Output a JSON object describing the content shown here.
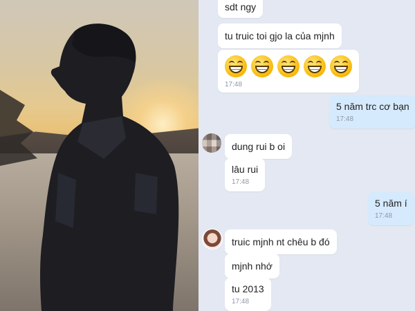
{
  "photo": {
    "alt": "Silhouette of a young man at sunset by a lake"
  },
  "chat": {
    "messages": [
      {
        "id": "m1",
        "direction": "in",
        "text": "sdt ngy",
        "time": ""
      },
      {
        "id": "m2",
        "direction": "in",
        "text": "tu truic toi gjo la của mjnh",
        "time": ""
      },
      {
        "id": "m3",
        "direction": "in",
        "emoji_count": 5,
        "emoji": "grinning-face",
        "time": "17:48"
      },
      {
        "id": "m4",
        "direction": "out",
        "text": "5 năm trc cơ bạn",
        "time": "17:48"
      },
      {
        "id": "m5",
        "direction": "in",
        "text": "dung rui b oi",
        "time": ""
      },
      {
        "id": "m6",
        "direction": "in",
        "text": "lâu rui",
        "time": "17:48"
      },
      {
        "id": "m7",
        "direction": "out",
        "text": "5 năm í",
        "time": "17:48"
      },
      {
        "id": "m8",
        "direction": "in",
        "text": "truic mjnh nt chêu b đó",
        "time": ""
      },
      {
        "id": "m9",
        "direction": "in",
        "text": "mjnh nhớ",
        "time": ""
      },
      {
        "id": "m10",
        "direction": "in",
        "text": "tu 2013",
        "time": "17:48"
      }
    ]
  },
  "colors": {
    "chat_bg": "#e3e8f3",
    "incoming_bubble": "#ffffff",
    "outgoing_bubble": "#d5eafc",
    "time_text": "#8e97a4"
  }
}
